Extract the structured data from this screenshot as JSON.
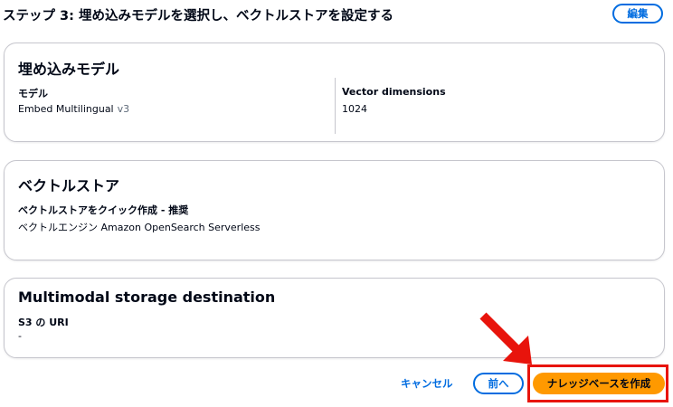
{
  "header": {
    "title": "ステップ 3: 埋め込みモデルを選択し、ベクトルストアを設定する",
    "edit_label": "編集"
  },
  "embedding_model": {
    "title": "埋め込みモデル",
    "model_label": "モデル",
    "model_value": "Embed Multilingual",
    "model_version": "v3",
    "dimensions_label": "Vector dimensions",
    "dimensions_value": "1024"
  },
  "vector_store": {
    "title": "ベクトルストア",
    "quick_create_label": "ベクトルストアをクイック作成 - 推奨",
    "engine_value": "ベクトルエンジン Amazon OpenSearch Serverless"
  },
  "multimodal_storage": {
    "title": "Multimodal storage destination",
    "uri_label": "S3 の URI",
    "uri_value": "-"
  },
  "footer": {
    "cancel_label": "キャンセル",
    "previous_label": "前へ",
    "create_label": "ナレッジベースを作成"
  },
  "colors": {
    "accent": "#006ce0",
    "primary_button": "#ff9900",
    "annotation_red": "#e8140c"
  }
}
